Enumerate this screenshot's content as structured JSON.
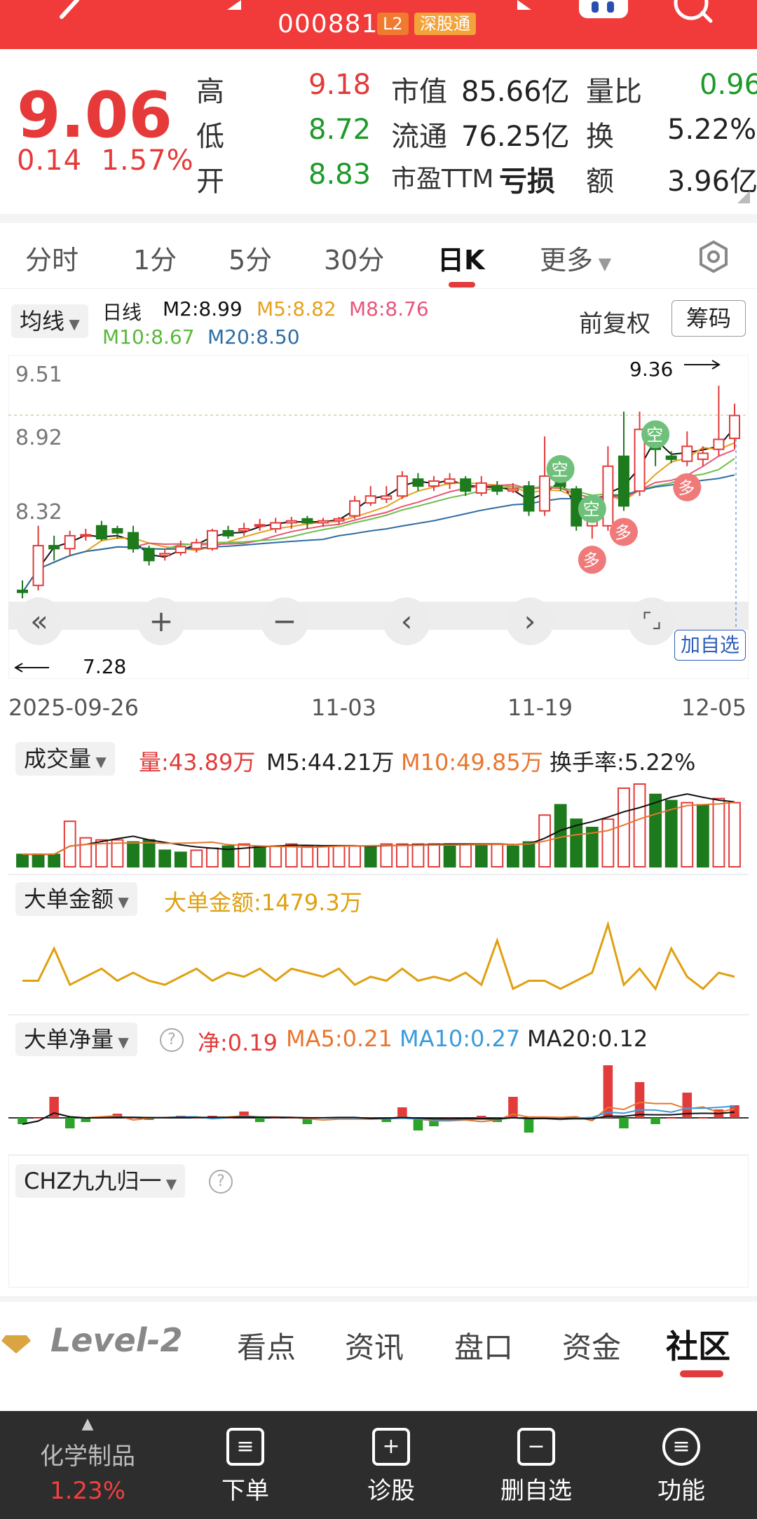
{
  "header": {
    "code": "000881",
    "l2_badge": "L2",
    "connect_badge": "深股通"
  },
  "quote": {
    "price": "9.06",
    "change": "0.14",
    "change_pct": "1.57%",
    "high_label": "高",
    "high": "9.18",
    "low_label": "低",
    "low": "8.72",
    "open_label": "开",
    "open": "8.83",
    "mktcap_label": "市值",
    "mktcap": "85.66亿",
    "float_label": "流通",
    "float": "76.25亿",
    "pe_label": "市盈TTM",
    "pe": "亏损",
    "volratio_label": "量比",
    "volratio": "0.96",
    "turnover_label": "换",
    "turnover": "5.22%",
    "amount_label": "额",
    "amount": "3.96亿"
  },
  "tabs": [
    "分时",
    "1分",
    "5分",
    "30分",
    "日K",
    "更多"
  ],
  "active_tab": "日K",
  "kline": {
    "indicator_select": "均线",
    "period": "日线",
    "m2": "M2:8.99",
    "m5": "M5:8.82",
    "m8": "M8:8.76",
    "m10": "M10:8.67",
    "m20": "M20:8.50",
    "adjust": "前复权",
    "chips_button": "筹码",
    "y_labels": [
      "9.51",
      "8.92",
      "8.32"
    ],
    "high_marker": "9.36",
    "low_marker": "7.28",
    "x_labels": [
      "2025-09-26",
      "11-03",
      "11-19",
      "12-05"
    ],
    "add_watch": "加自选",
    "kong": "空",
    "duo": "多"
  },
  "volume": {
    "select": "成交量",
    "vol": "量:43.89万",
    "m5": "M5:44.21万",
    "m10": "M10:49.85万",
    "turnover": "换手率:5.22%"
  },
  "bigorder": {
    "select": "大单金额",
    "value": "大单金额:1479.3万"
  },
  "bignet": {
    "select": "大单净量",
    "net": "净:0.19",
    "ma5": "MA5:0.21",
    "ma10": "MA10:0.27",
    "ma20": "MA20:0.12"
  },
  "chz": {
    "select": "CHZ九九归一"
  },
  "bottom_tabs": [
    "Level-2",
    "看点",
    "资讯",
    "盘口",
    "资金",
    "社区"
  ],
  "bottom_bar": {
    "sector": "化学制品",
    "sector_pct": "1.23%",
    "items": [
      "下单",
      "诊股",
      "删自选",
      "功能"
    ]
  },
  "colors": {
    "up": "#e23b3b",
    "down": "#1d7a1d",
    "ma2": "#111111",
    "ma5": "#e6a11d",
    "ma8": "#e8557a",
    "ma10": "#6cc04a",
    "ma20": "#2e6da4"
  },
  "chart_data": {
    "type": "candlestick",
    "candles": [
      {
        "o": 7.3,
        "c": 7.28,
        "h": 7.4,
        "l": 7.22
      },
      {
        "o": 7.35,
        "c": 7.75,
        "h": 7.95,
        "l": 7.3
      },
      {
        "o": 7.75,
        "c": 7.72,
        "h": 7.85,
        "l": 7.6
      },
      {
        "o": 7.72,
        "c": 7.85,
        "h": 7.9,
        "l": 7.65
      },
      {
        "o": 7.85,
        "c": 7.86,
        "h": 7.92,
        "l": 7.8
      },
      {
        "o": 7.95,
        "c": 7.82,
        "h": 8.0,
        "l": 7.8
      },
      {
        "o": 7.92,
        "c": 7.88,
        "h": 7.95,
        "l": 7.82
      },
      {
        "o": 7.88,
        "c": 7.72,
        "h": 7.95,
        "l": 7.68
      },
      {
        "o": 7.72,
        "c": 7.6,
        "h": 7.75,
        "l": 7.55
      },
      {
        "o": 7.65,
        "c": 7.67,
        "h": 7.72,
        "l": 7.6
      },
      {
        "o": 7.68,
        "c": 7.74,
        "h": 7.8,
        "l": 7.65
      },
      {
        "o": 7.72,
        "c": 7.78,
        "h": 7.82,
        "l": 7.68
      },
      {
        "o": 7.72,
        "c": 7.9,
        "h": 7.92,
        "l": 7.7
      },
      {
        "o": 7.9,
        "c": 7.85,
        "h": 7.95,
        "l": 7.82
      },
      {
        "o": 7.9,
        "c": 7.92,
        "h": 7.98,
        "l": 7.85
      },
      {
        "o": 7.95,
        "c": 7.96,
        "h": 8.02,
        "l": 7.9
      },
      {
        "o": 7.92,
        "c": 7.98,
        "h": 8.03,
        "l": 7.88
      },
      {
        "o": 7.98,
        "c": 8.0,
        "h": 8.04,
        "l": 7.92
      },
      {
        "o": 8.02,
        "c": 7.98,
        "h": 8.05,
        "l": 7.92
      },
      {
        "o": 7.98,
        "c": 8.0,
        "h": 8.03,
        "l": 7.94
      },
      {
        "o": 8.0,
        "c": 8.02,
        "h": 8.04,
        "l": 7.96
      },
      {
        "o": 8.05,
        "c": 8.2,
        "h": 8.25,
        "l": 8.02
      },
      {
        "o": 8.18,
        "c": 8.25,
        "h": 8.35,
        "l": 8.15
      },
      {
        "o": 8.22,
        "c": 8.25,
        "h": 8.35,
        "l": 8.18
      },
      {
        "o": 8.25,
        "c": 8.45,
        "h": 8.5,
        "l": 8.22
      },
      {
        "o": 8.42,
        "c": 8.35,
        "h": 8.48,
        "l": 8.3
      },
      {
        "o": 8.35,
        "c": 8.4,
        "h": 8.45,
        "l": 8.3
      },
      {
        "o": 8.38,
        "c": 8.42,
        "h": 8.48,
        "l": 8.32
      },
      {
        "o": 8.42,
        "c": 8.3,
        "h": 8.45,
        "l": 8.25
      },
      {
        "o": 8.28,
        "c": 8.38,
        "h": 8.45,
        "l": 8.25
      },
      {
        "o": 8.35,
        "c": 8.3,
        "h": 8.4,
        "l": 8.26
      },
      {
        "o": 8.3,
        "c": 8.32,
        "h": 8.38,
        "l": 8.28
      },
      {
        "o": 8.35,
        "c": 8.1,
        "h": 8.4,
        "l": 8.05
      },
      {
        "o": 8.1,
        "c": 8.45,
        "h": 8.85,
        "l": 8.05
      },
      {
        "o": 8.4,
        "c": 8.35,
        "h": 8.45,
        "l": 8.3
      },
      {
        "o": 8.32,
        "c": 7.95,
        "h": 8.35,
        "l": 7.9
      },
      {
        "o": 7.95,
        "c": 8.0,
        "h": 8.05,
        "l": 7.82
      },
      {
        "o": 7.95,
        "c": 8.55,
        "h": 8.75,
        "l": 7.9
      },
      {
        "o": 8.65,
        "c": 8.15,
        "h": 9.1,
        "l": 8.1
      },
      {
        "o": 8.3,
        "c": 8.92,
        "h": 9.1,
        "l": 8.25
      },
      {
        "o": 8.78,
        "c": 8.72,
        "h": 8.8,
        "l": 8.55
      },
      {
        "o": 8.65,
        "c": 8.62,
        "h": 8.7,
        "l": 8.58
      },
      {
        "o": 8.6,
        "c": 8.75,
        "h": 8.9,
        "l": 8.55
      },
      {
        "o": 8.62,
        "c": 8.68,
        "h": 8.75,
        "l": 8.55
      },
      {
        "o": 8.72,
        "c": 8.82,
        "h": 9.36,
        "l": 8.65
      },
      {
        "o": 8.83,
        "c": 9.06,
        "h": 9.18,
        "l": 8.72
      }
    ],
    "ylim": [
      7.2,
      9.6
    ],
    "volume": [
      6,
      6,
      6,
      22,
      14,
      13,
      13,
      12,
      13,
      8,
      7,
      8,
      9,
      10,
      11,
      10,
      10,
      11,
      10,
      10,
      10,
      10,
      10,
      11,
      11,
      11,
      11,
      11,
      11,
      11,
      11,
      10,
      12,
      25,
      30,
      23,
      19,
      23,
      38,
      40,
      35,
      32,
      31,
      30,
      33,
      31
    ],
    "volume_up": [
      0,
      0,
      0,
      1,
      1,
      1,
      1,
      0,
      0,
      0,
      0,
      1,
      1,
      0,
      1,
      0,
      1,
      1,
      1,
      1,
      1,
      1,
      0,
      1,
      1,
      1,
      1,
      0,
      1,
      0,
      1,
      0,
      0,
      1,
      0,
      0,
      0,
      1,
      1,
      1,
      0,
      0,
      1,
      0,
      1,
      1
    ],
    "bigorder_amount": [
      30,
      30,
      70,
      25,
      35,
      45,
      30,
      40,
      30,
      25,
      35,
      45,
      30,
      40,
      35,
      45,
      30,
      45,
      40,
      35,
      45,
      25,
      35,
      30,
      45,
      30,
      35,
      30,
      40,
      25,
      80,
      20,
      30,
      30,
      20,
      30,
      40,
      100,
      25,
      45,
      20,
      70,
      35,
      20,
      40,
      35
    ],
    "bignet": [
      -0.03,
      0.0,
      0.1,
      -0.05,
      -0.02,
      0.0,
      0.02,
      0.0,
      -0.01,
      0.0,
      0.01,
      0.0,
      0.01,
      0.0,
      0.03,
      -0.02,
      0.0,
      0.0,
      -0.03,
      0.0,
      0.0,
      0.0,
      0.0,
      -0.02,
      0.05,
      -0.06,
      -0.04,
      0.0,
      0.0,
      0.01,
      -0.02,
      0.1,
      -0.07,
      0.0,
      0.0,
      0.0,
      0.0,
      0.25,
      -0.05,
      0.17,
      -0.03,
      0.0,
      0.12,
      0.0,
      0.04,
      0.06
    ]
  }
}
